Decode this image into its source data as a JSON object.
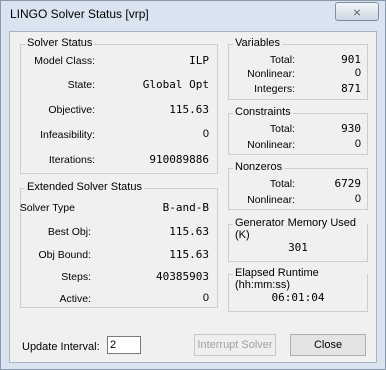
{
  "window": {
    "title": "LINGO Solver Status [vrp]",
    "close_glyph": "⨯"
  },
  "solver_status": {
    "title": "Solver Status",
    "model_class_label": "Model Class:",
    "model_class": "ILP",
    "state_label": "State:",
    "state": "Global Opt",
    "objective_label": "Objective:",
    "objective": "115.63",
    "infeasibility_label": "Infeasibility:",
    "infeasibility": "0",
    "iterations_label": "Iterations:",
    "iterations": "910089886"
  },
  "extended_status": {
    "title": "Extended Solver Status",
    "solver_type_label": "Solver Type",
    "solver_type": "B-and-B",
    "best_obj_label": "Best Obj:",
    "best_obj": "115.63",
    "obj_bound_label": "Obj Bound:",
    "obj_bound": "115.63",
    "steps_label": "Steps:",
    "steps": "40385903",
    "active_label": "Active:",
    "active": "0"
  },
  "variables": {
    "title": "Variables",
    "total_label": "Total:",
    "total": "901",
    "nonlinear_label": "Nonlinear:",
    "nonlinear": "0",
    "integers_label": "Integers:",
    "integers": "871"
  },
  "constraints": {
    "title": "Constraints",
    "total_label": "Total:",
    "total": "930",
    "nonlinear_label": "Nonlinear:",
    "nonlinear": "0"
  },
  "nonzeros": {
    "title": "Nonzeros",
    "total_label": "Total:",
    "total": "6729",
    "nonlinear_label": "Nonlinear:",
    "nonlinear": "0"
  },
  "memory": {
    "title": "Generator Memory Used (K)",
    "value": "301"
  },
  "runtime": {
    "title": "Elapsed Runtime (hh:mm:ss)",
    "value": "06:01:04"
  },
  "footer": {
    "update_interval_label": "Update Interval:",
    "update_interval_value": "2",
    "interrupt_label": "Interrupt Solver",
    "close_label": "Close"
  }
}
